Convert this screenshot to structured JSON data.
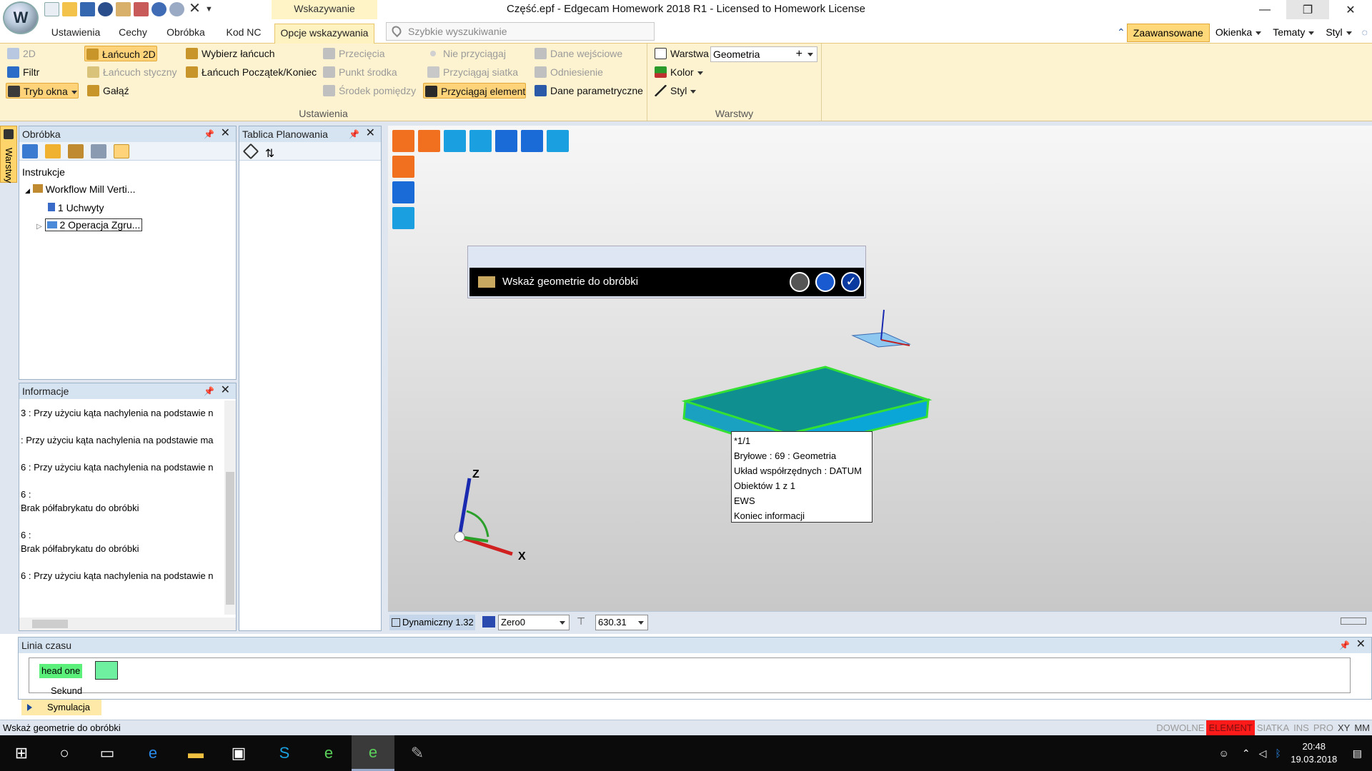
{
  "window": {
    "title": "Część.epf - Edgecam Homework 2018 R1  - Licensed to Homework License",
    "context_tab": "Wskazywanie",
    "minimize": "—",
    "maximize": "❐",
    "close": "✕"
  },
  "tabs": [
    "Ustawienia",
    "Cechy",
    "Obróbka",
    "Kod NC",
    "Opcje wskazywania"
  ],
  "search": {
    "placeholder": "Szybkie wyszukiwanie"
  },
  "right_tabs": {
    "zaawansowane": "Zaawansowane",
    "okienka": "Okienka",
    "tematy": "Tematy",
    "styl": "Styl"
  },
  "ribbon": {
    "ustawienia_label": "Ustawienia",
    "warstwy_label": "Warstwy",
    "items": {
      "mode2d": "2D",
      "filtr": "Filtr",
      "tryb_okna": "Tryb okna",
      "lancuch2d": "Łańcuch 2D",
      "lancuch_styczny": "Łańcuch styczny",
      "galaz": "Gałąź",
      "wybierz_lancuch": "Wybierz łańcuch",
      "lancuch_pk": "Łańcuch Początek/Koniec",
      "przeciecia": "Przecięcia",
      "punkt_srodka": "Punkt środka",
      "srodek_pomiedzy": "Środek pomiędzy",
      "nie_przyciagaj": "Nie przyciągaj",
      "przyciagaj_siatka": "Przyciągaj siatka",
      "przyciagaj_element": "Przyciągaj element",
      "dane_wejsciowe": "Dane wejściowe",
      "odniesienie": "Odniesienie",
      "dane_parametryczne": "Dane parametryczne",
      "warstwa": "Warstwa",
      "kolor": "Kolor",
      "styl": "Styl",
      "warstwa_value": "Geometria"
    }
  },
  "side_strip": {
    "label": "Warstwy"
  },
  "obrobka_panel": {
    "title": "Obróbka",
    "tree": {
      "root": "Instrukcje",
      "workflow": "Workflow Mill Verti...",
      "uchwyty": "1 Uchwyty",
      "operacja": "2 Operacja Zgru..."
    }
  },
  "tablica_panel": {
    "title": "Tablica Planowania"
  },
  "informacje_panel": {
    "title": "Informacje",
    "lines": [
      "3 : Przy użyciu kąta nachylenia na podstawie n",
      "",
      " : Przy użyciu kąta nachylenia na podstawie ma",
      "",
      "6 : Przy użyciu kąta nachylenia na podstawie n",
      "",
      "6 :",
      "Brak półfabrykatu do obróbki",
      "",
      "6 :",
      "Brak półfabrykatu do obróbki",
      "",
      "6 : Przy użyciu kąta nachylenia na podstawie n"
    ]
  },
  "prompt": {
    "text": "Wskaż geometrie do obróbki"
  },
  "tooltip": {
    "lines": [
      "*1/1",
      "Bryłowe : 69 : Geometria",
      "Układ współrzędnych : DATUM",
      "Obiektów 1 z 1",
      "EWS",
      "Koniec informacji"
    ]
  },
  "axes": {
    "z": "Z",
    "x": "X"
  },
  "viewport_status": {
    "mode": "Dynamiczny 1.32",
    "cpl": "Zero0",
    "value": "630.31"
  },
  "timeline": {
    "title": "Linia czasu",
    "head": "head one",
    "sekund": "Sekund"
  },
  "symulacja": "Symulacja",
  "statusbar": {
    "message": "Wskaż geometrie do obróbki",
    "flags": [
      "DOWOLNE",
      "ELEMENT",
      "SIATKA",
      "INS",
      "PRO",
      "XY",
      "MM"
    ]
  },
  "taskbar": {
    "time": "20:48",
    "date": "19.03.2018"
  }
}
